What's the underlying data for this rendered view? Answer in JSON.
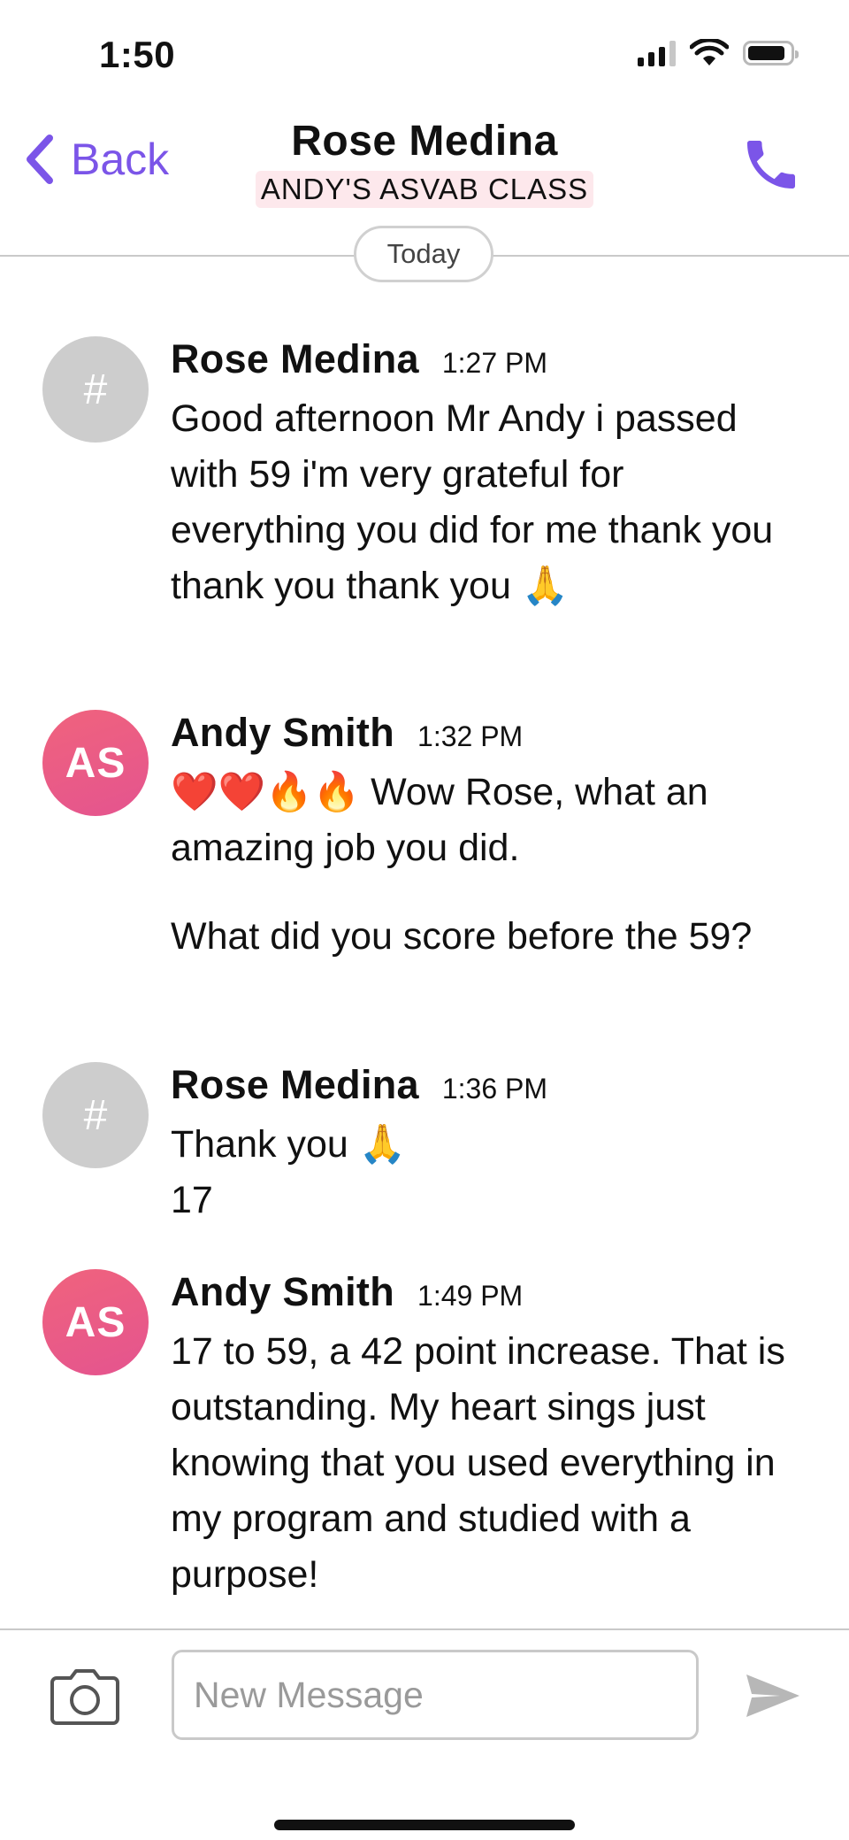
{
  "status_bar": {
    "time": "1:50",
    "icons": [
      "cellular-signal-icon",
      "wifi-icon",
      "battery-icon"
    ],
    "signal_bars": 3,
    "battery_level": 0.85
  },
  "header": {
    "back_label": "Back",
    "title": "Rose Medina",
    "group": "ANDY'S ASVAB CLASS",
    "call_icon": "phone-icon",
    "accent_color": "#7b55e8"
  },
  "divider": {
    "label": "Today"
  },
  "messages": [
    {
      "sender": "Rose Medina",
      "time": "1:27 PM",
      "avatar": "#",
      "paragraphs": [
        "Good afternoon Mr Andy i passed with 59 i'm very grateful for everything you did for me thank you thank you thank you 🙏"
      ]
    },
    {
      "sender": "Andy Smith",
      "time": "1:32 PM",
      "avatar": "AS",
      "paragraphs": [
        "❤️❤️🔥🔥 Wow Rose, what an amazing job you did.",
        "What did you score before the 59?"
      ]
    },
    {
      "sender": "Rose Medina",
      "time": "1:36 PM",
      "avatar": "#",
      "paragraphs": [
        "Thank you 🙏",
        "17"
      ]
    },
    {
      "sender": "Andy Smith",
      "time": "1:49 PM",
      "avatar": "AS",
      "paragraphs": [
        "17 to 59, a 42 point increase. That is outstanding. My heart sings just knowing that you used everything in my program and studied with a purpose!"
      ]
    }
  ],
  "composer": {
    "placeholder": "New Message",
    "value": "",
    "camera_icon": "camera-icon",
    "send_icon": "send-icon"
  },
  "colors": {
    "accent": "#7b55e8",
    "avatar_initials": "#ea5a86",
    "avatar_hash": "#cdcdcd",
    "badge_bg": "#fde8ec"
  }
}
